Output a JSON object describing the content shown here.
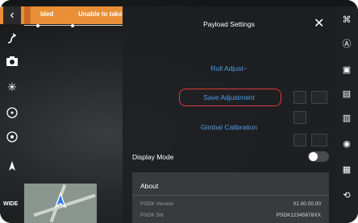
{
  "status_bar": {
    "text_left": "lded",
    "text_right": "Unable to take st"
  },
  "panel": {
    "title": "Payload Settings",
    "menu": [
      "Roll Adjust~",
      "Save Adjustment",
      "Gimbal Calibration"
    ],
    "display_mode_label": "Display Mode",
    "display_mode_on": false,
    "about": {
      "heading": "About",
      "rows": [
        {
          "label": "PSDK Version",
          "value": "01.00.00.00"
        },
        {
          "label": "PSDK SN",
          "value": "PSDK12345678XX"
        }
      ]
    }
  },
  "left_rail": {
    "lens_label": "WIDE"
  },
  "colors": {
    "accent": "#e98f38",
    "link": "#4d9eea",
    "highlight": "#e03a3a"
  }
}
